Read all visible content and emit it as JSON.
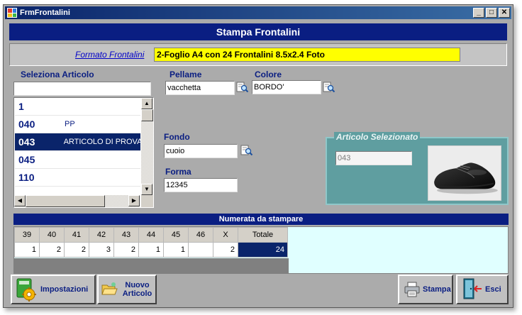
{
  "window": {
    "title": "FrmFrontalini",
    "buttons": [
      "_",
      "□",
      "✕"
    ]
  },
  "header": {
    "title": "Stampa Frontalini"
  },
  "format": {
    "link_label": "Formato Frontalini",
    "value": "2-Foglio A4 con 24 Frontalini  8.5x2.4  Foto"
  },
  "articolo": {
    "label": "Seleziona Articolo",
    "search_value": "",
    "items": [
      {
        "code": "1",
        "desc": ""
      },
      {
        "code": "040",
        "desc": "PP"
      },
      {
        "code": "043",
        "desc": "ARTICOLO DI PROVA"
      },
      {
        "code": "045",
        "desc": ""
      },
      {
        "code": "110",
        "desc": ""
      }
    ],
    "selected_index": 2
  },
  "pellame": {
    "label": "Pellame",
    "value": "vacchetta"
  },
  "colore": {
    "label": "Colore",
    "value": "BORDO'"
  },
  "fondo": {
    "label": "Fondo",
    "value": "cuoio"
  },
  "forma": {
    "label": "Forma",
    "value": "12345"
  },
  "selected_article": {
    "title": "Articolo Selezionato",
    "code": "043"
  },
  "numerata": {
    "title": "Numerata da stampare",
    "headers": [
      "39",
      "40",
      "41",
      "42",
      "43",
      "44",
      "45",
      "46",
      "X",
      "Totale"
    ],
    "values": [
      "1",
      "2",
      "2",
      "3",
      "2",
      "1",
      "1",
      "",
      "2",
      "24"
    ]
  },
  "toolbar": {
    "impostazioni": "Impostazioni",
    "nuovo_articolo_1": "Nuovo",
    "nuovo_articolo_2": "Articolo",
    "stampa": "Stampa",
    "esci": "Esci"
  },
  "colors": {
    "header_blue": "#0a1e82",
    "selection_blue": "#0a246a",
    "highlight_yellow": "#ffff00",
    "group_teal": "#5f9ea0",
    "grid_bg": "#e0ffff"
  }
}
